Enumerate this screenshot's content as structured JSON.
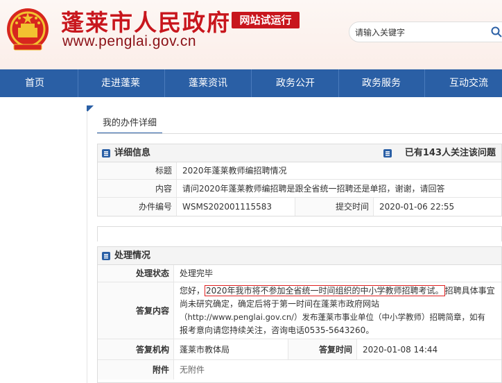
{
  "header": {
    "site_title": "蓬莱市人民政府",
    "trial_badge": "网站试运行",
    "site_url": "www.penglai.gov.cn",
    "search_placeholder": "请输入关键字"
  },
  "nav": {
    "items": [
      "首页",
      "走进蓬莱",
      "蓬莱资讯",
      "政务公开",
      "政务服务",
      "互动交流"
    ]
  },
  "panel": {
    "tab_title": "我的办件详细"
  },
  "details": {
    "section_title": "详细信息",
    "follow_text": "已有143人关注该问题",
    "title_label": "标题",
    "title_value": "2020年蓬莱教师编招聘情况",
    "content_label": "内容",
    "content_value": "请问2020年蓬莱教师编招聘是跟全省统一招聘还是单招，谢谢，请回答",
    "number_label": "办件编号",
    "number_value": "WSMS202001115583",
    "submit_label": "提交时间",
    "submit_value": "2020-01-06 22:55"
  },
  "processing": {
    "section_title": "处理情况",
    "status_label": "处理状态",
    "status_value": "处理完毕",
    "reply_label": "答复内容",
    "reply_greeting": "您好，",
    "reply_highlight": "2020年我市将不参加全省统一时间组织的中小学教师招聘考试。",
    "reply_rest1": "招聘具体事宜",
    "reply_line2": "尚未研究确定，确定后将于第一时间在蓬莱市政府网站",
    "reply_line3": "（http://www.penglai.gov.cn/）发布蓬莱市事业单位（中小学教师）招聘简章，如有",
    "reply_line4": "报考意向请您持续关注，咨询电话0535-5643260。",
    "org_label": "答复机构",
    "org_value": "蓬莱市教体局",
    "reply_time_label": "答复时间",
    "reply_time_value": "2020-01-08 14:44",
    "attach_label": "附件",
    "attach_value": "无附件"
  },
  "colors": {
    "brand_red": "#c8161d",
    "nav_blue": "#2a5fa5",
    "highlight_red": "#e02020"
  },
  "icons": [
    "emblem-icon",
    "search-icon",
    "list-icon",
    "user-list-icon"
  ]
}
